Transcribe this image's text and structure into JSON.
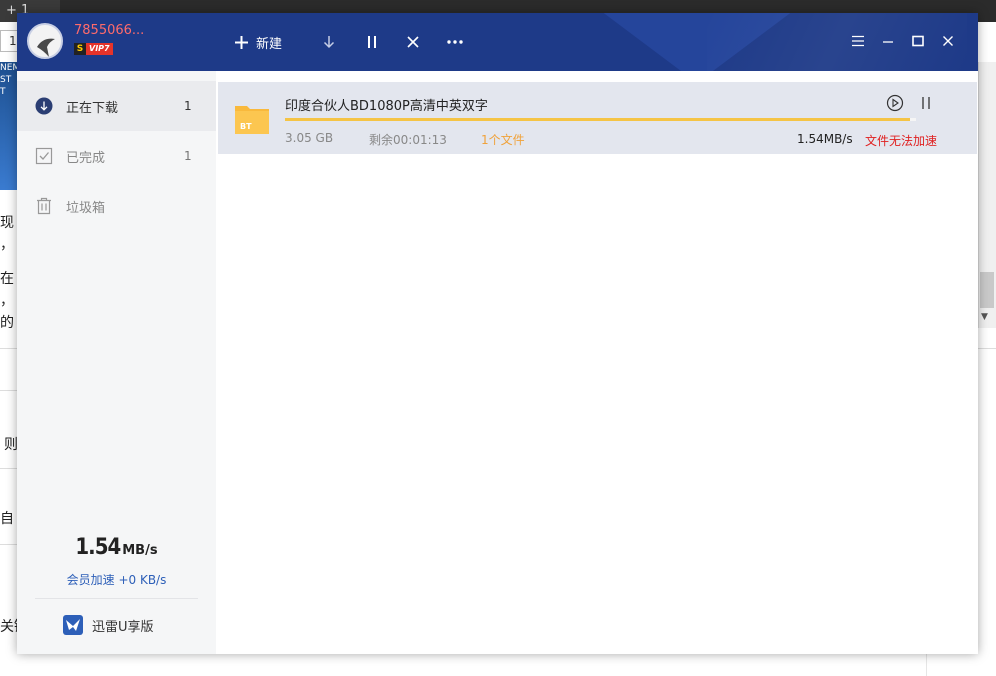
{
  "background": {
    "tab_label": "+ 1",
    "address_text": "1",
    "banner_text": "NEM ST T",
    "text_lines": [
      "现",
      "，",
      "在",
      "，",
      "的",
      "则",
      "自",
      "关键"
    ]
  },
  "app": {
    "user": {
      "name": "7855066...",
      "vip_badge_s": "S",
      "vip_badge_label": "VIP7"
    },
    "toolbar": {
      "new_label": "新建"
    },
    "sidebar": {
      "items": [
        {
          "label": "正在下载",
          "count": "1",
          "icon": "download-circle-icon"
        },
        {
          "label": "已完成",
          "count": "1",
          "icon": "check-box-icon"
        },
        {
          "label": "垃圾箱",
          "count": "",
          "icon": "trash-icon"
        }
      ],
      "speed_value": "1.54",
      "speed_unit": "MB/s",
      "vip_speed_text": "会员加速 +0 KB/s",
      "u_version_label": "迅雷U享版"
    },
    "tasks": [
      {
        "icon_label": "BT",
        "name": "印度合伙人BD1080P高清中英双字",
        "progress": 0.99,
        "size": "3.05 GB",
        "remaining": "剩余00:01:13",
        "files": "1个文件",
        "speed": "1.54MB/s",
        "warning": "文件无法加速"
      }
    ],
    "colors": {
      "titlebar": "#1e3a88",
      "progress": "#f5c445",
      "warning": "#e02020",
      "link": "#2d5fb8"
    }
  }
}
